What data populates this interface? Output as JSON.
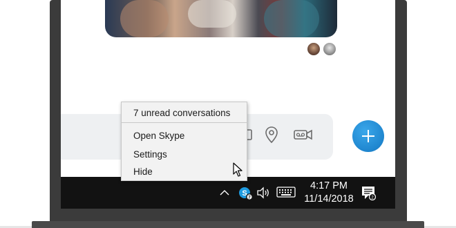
{
  "app": {
    "name": "Skype",
    "accent_color": "#1f86cf"
  },
  "chat": {
    "shared_photo": "group photo of friends",
    "reaction_avatars": [
      "avatar-1",
      "avatar-2"
    ]
  },
  "compose": {
    "icons": [
      "image-icon",
      "location-pin-icon",
      "video-message-icon"
    ]
  },
  "fab": {
    "icon": "plus-icon"
  },
  "context_menu": {
    "header": "7 unread conversations",
    "items": [
      {
        "label": "Open Skype"
      },
      {
        "label": "Settings"
      },
      {
        "label": "Hide"
      }
    ]
  },
  "taskbar": {
    "tray_icons": [
      "chevron-up-icon",
      "skype-tray-icon",
      "volume-icon",
      "keyboard-icon"
    ],
    "time": "4:17 PM",
    "date": "11/14/2018",
    "notification_icon": "action-center-icon"
  }
}
